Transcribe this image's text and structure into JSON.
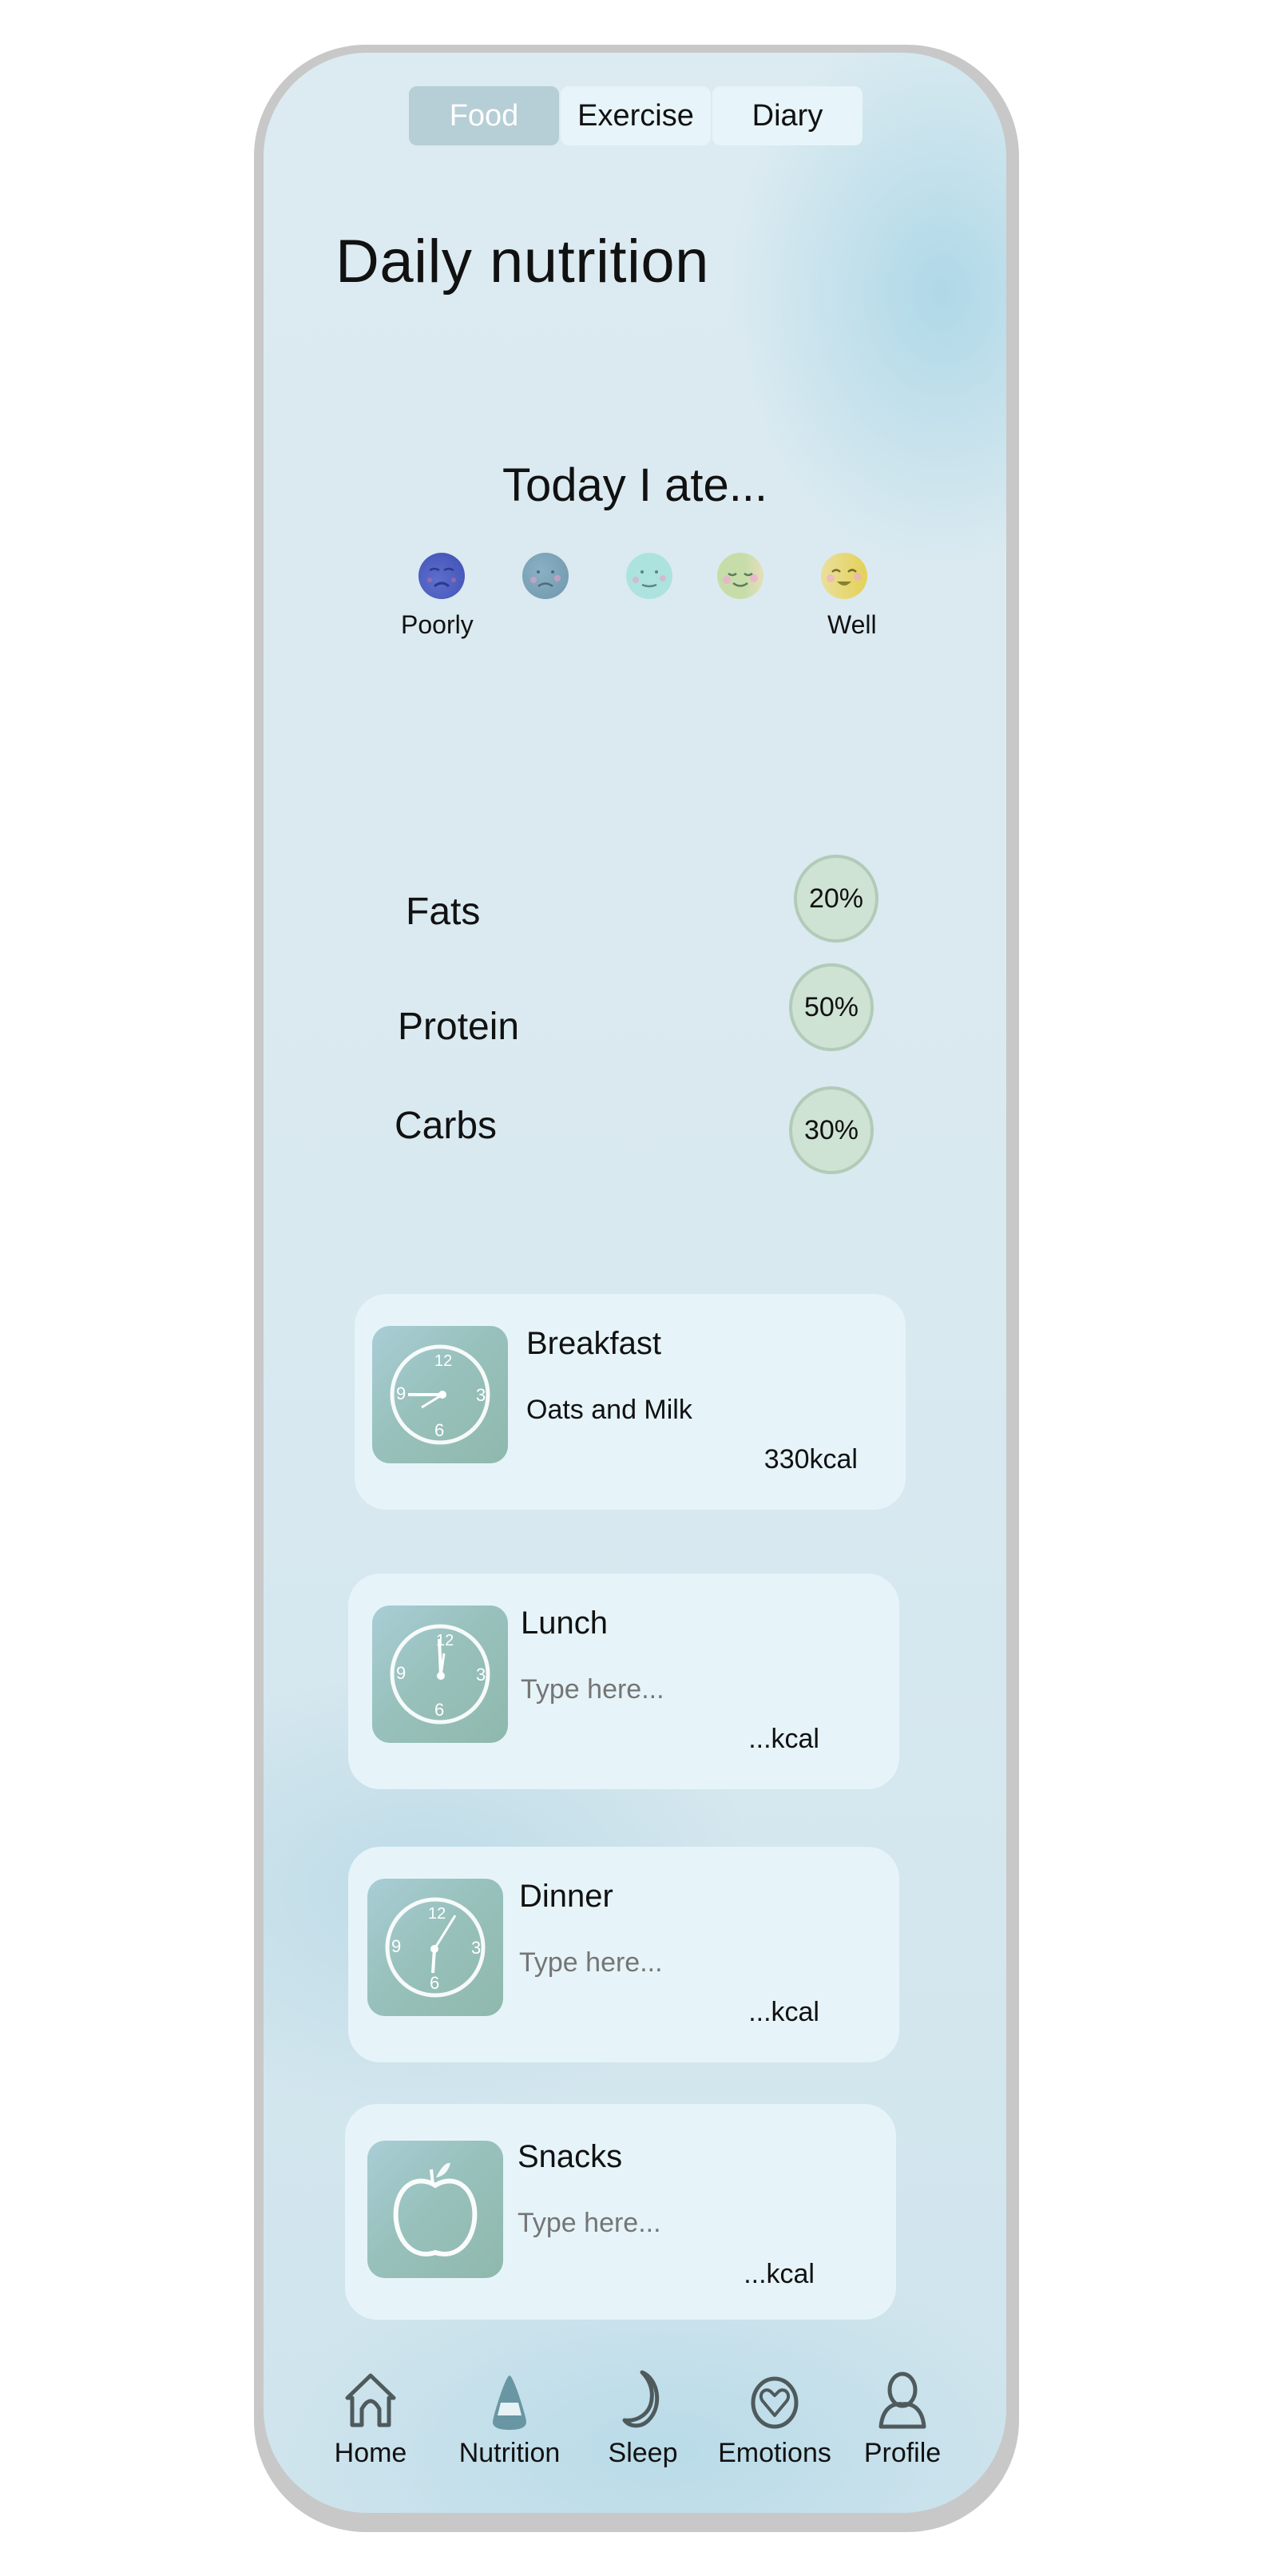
{
  "tabs": [
    {
      "label": "Food",
      "active": true
    },
    {
      "label": "Exercise",
      "active": false
    },
    {
      "label": "Diary",
      "active": false
    }
  ],
  "page_title": "Daily nutrition",
  "mood": {
    "heading": "Today I ate...",
    "scale_min_label": "Poorly",
    "scale_max_label": "Well",
    "faces": [
      {
        "icon": "very-sad-face-icon",
        "color": "#4a5cc0"
      },
      {
        "icon": "sad-face-icon",
        "color": "#7fa3b8"
      },
      {
        "icon": "neutral-face-icon",
        "color": "#a9e2de"
      },
      {
        "icon": "content-face-icon",
        "color": "#cfdeb0"
      },
      {
        "icon": "happy-face-icon",
        "color": "#ead979"
      }
    ]
  },
  "macros": [
    {
      "label": "Fats",
      "percent": "20%"
    },
    {
      "label": "Protein",
      "percent": "50%"
    },
    {
      "label": "Carbs",
      "percent": "30%"
    }
  ],
  "meals": [
    {
      "title": "Breakfast",
      "description": "Oats and Milk",
      "placeholder": "Type here...",
      "kcal": "330kcal",
      "icon": "clock-icon"
    },
    {
      "title": "Lunch",
      "description": "",
      "placeholder": "Type here...",
      "kcal": "...kcal",
      "icon": "clock-icon"
    },
    {
      "title": "Dinner",
      "description": "",
      "placeholder": "Type here...",
      "kcal": "...kcal",
      "icon": "clock-icon"
    },
    {
      "title": "Snacks",
      "description": "",
      "placeholder": "Type here...",
      "kcal": "...kcal",
      "icon": "apple-icon"
    }
  ],
  "bottom_nav": [
    {
      "label": "Home",
      "icon": "home-icon",
      "active": false
    },
    {
      "label": "Nutrition",
      "icon": "nutrition-icon",
      "active": true
    },
    {
      "label": "Sleep",
      "icon": "moon-icon",
      "active": false
    },
    {
      "label": "Emotions",
      "icon": "heart-icon",
      "active": false
    },
    {
      "label": "Profile",
      "icon": "profile-icon",
      "active": false
    }
  ],
  "colors": {
    "active_tab": "#b6ced5",
    "inactive_tab": "#e7f4f9",
    "card": "#e6f4f9",
    "bubble_fill": "#cfe3d4",
    "bubble_border": "#b2cbb8",
    "nav_active": "#6996a3",
    "nav_icon": "#4e5a5c"
  }
}
